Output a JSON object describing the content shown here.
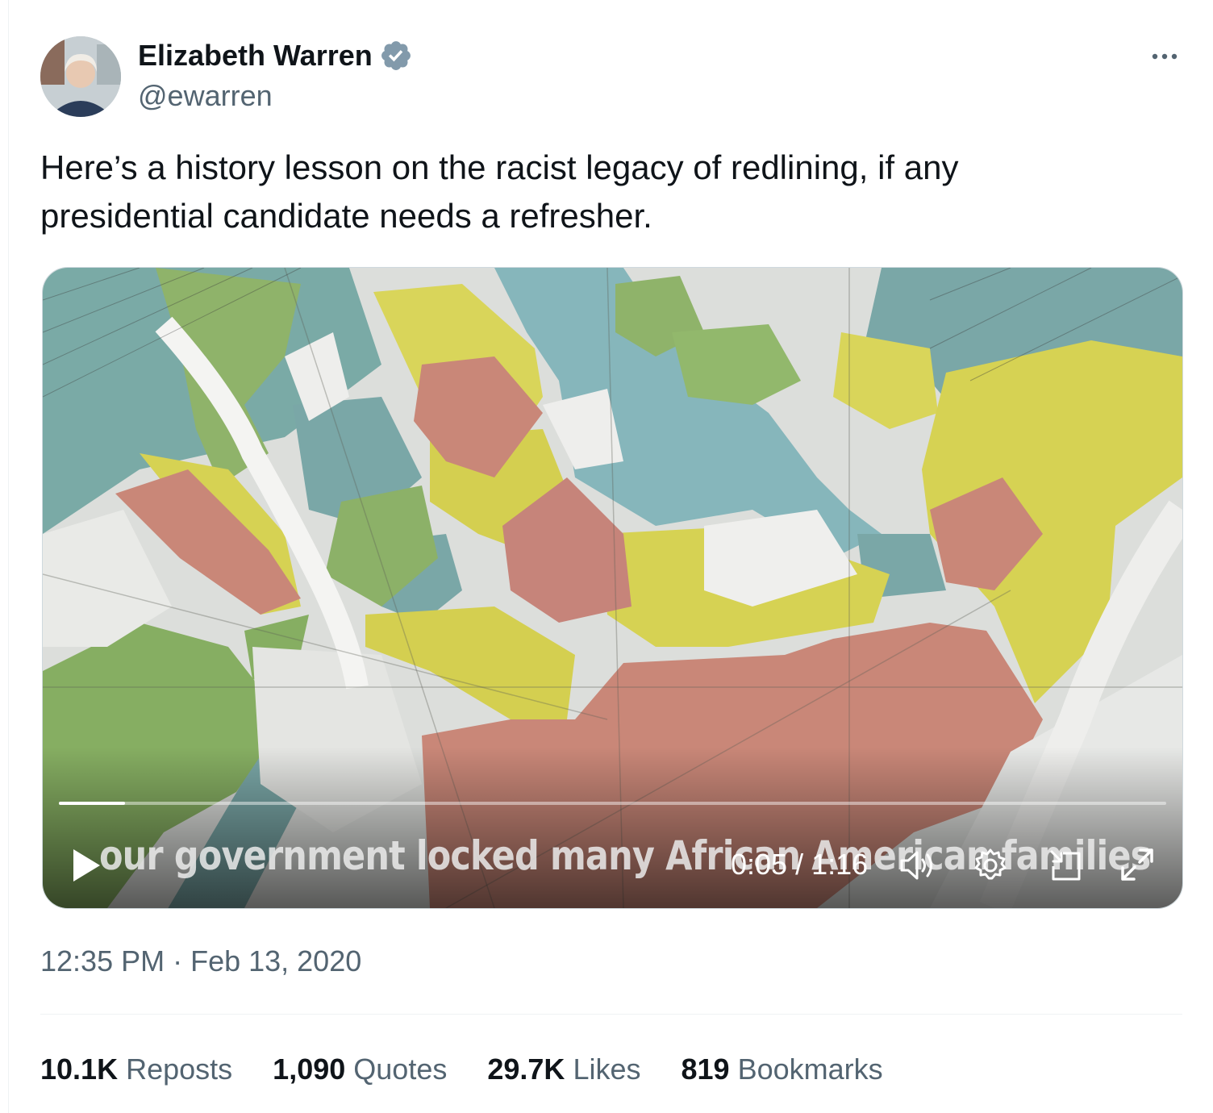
{
  "author": {
    "name": "Elizabeth Warren",
    "handle": "@ewarren",
    "verified_color": "#829aab"
  },
  "tweet": {
    "text_line1": "Here’s a history lesson on the racist legacy of redlining, if any",
    "text_line2": "presidential candidate needs a refresher."
  },
  "video": {
    "caption": "our government locked many African American families",
    "current_time": "0:05",
    "duration": "1:16",
    "time_display": "0:05 / 1:16",
    "progress_fraction": 0.06
  },
  "meta": {
    "timestamp": "12:35 PM · Feb 13, 2020"
  },
  "stats": {
    "reposts": {
      "num": "10.1K",
      "label": "Reposts"
    },
    "quotes": {
      "num": "1,090",
      "label": "Quotes"
    },
    "likes": {
      "num": "29.7K",
      "label": "Likes"
    },
    "bookmarks": {
      "num": "819",
      "label": "Bookmarks"
    }
  },
  "icons": [
    "more-icon",
    "verified-icon",
    "play-icon",
    "volume-icon",
    "settings-icon",
    "pip-icon",
    "fullscreen-icon"
  ]
}
